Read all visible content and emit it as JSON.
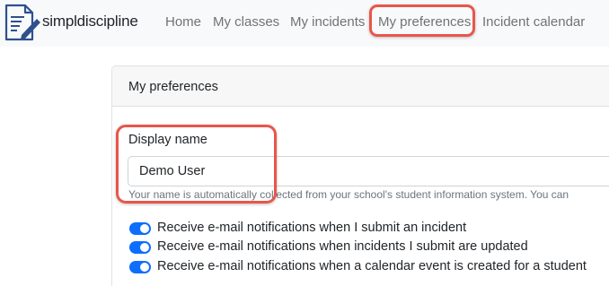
{
  "navbar": {
    "brand": "simpldiscipline",
    "logo_icon": "document-pencil-icon",
    "items": [
      {
        "label": "Home"
      },
      {
        "label": "My classes"
      },
      {
        "label": "My incidents"
      },
      {
        "label": "My preferences",
        "active": true
      },
      {
        "label": "Incident calendar"
      }
    ]
  },
  "card": {
    "title": "My preferences"
  },
  "display_name": {
    "label": "Display name",
    "value": "Demo User",
    "help": "Your name is automatically collected from your school's student information system. You can"
  },
  "switches": [
    {
      "label": "Receive e-mail notifications when I submit an incident",
      "checked": true
    },
    {
      "label": "Receive e-mail notifications when incidents I submit are updated",
      "checked": true
    },
    {
      "label": "Receive e-mail notifications when a calendar event is created for a student",
      "checked": true
    }
  ],
  "colors": {
    "highlight": "#e8564b",
    "switch_on": "#0d6efd",
    "logo": "#2f4f8f"
  }
}
